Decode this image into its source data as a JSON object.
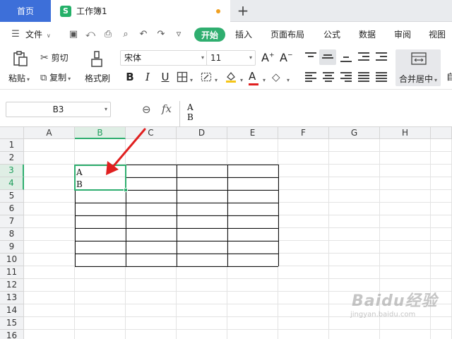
{
  "tabs": {
    "home": "首页",
    "document": "工作簿1",
    "new_tab": "+"
  },
  "menu": {
    "file": "文件",
    "items": [
      "开始",
      "插入",
      "页面布局",
      "公式",
      "数据",
      "审阅",
      "视图"
    ]
  },
  "ribbon": {
    "paste": "粘贴",
    "cut": "剪切",
    "copy": "复制",
    "format_painter": "格式刷",
    "font_name": "宋体",
    "font_size": "11",
    "merge_center": "合并居中",
    "partial_label": "自"
  },
  "formula_bar": {
    "name_box": "B3",
    "fx": "fx",
    "content": "A\nB"
  },
  "sheet": {
    "columns": [
      "A",
      "B",
      "C",
      "D",
      "E",
      "F",
      "G",
      "H"
    ],
    "selected_column": "B",
    "rows": [
      "1",
      "2",
      "3",
      "4",
      "5",
      "6",
      "7",
      "8",
      "9",
      "10",
      "11",
      "12",
      "13",
      "14",
      "15",
      "16"
    ],
    "selected_rows": [
      "3",
      "4"
    ],
    "active_cell_text": "A\nB"
  },
  "watermark": {
    "brand": "Baidu经验",
    "url": "jingyan.baidu.com"
  },
  "colors": {
    "accent_green": "#2fae6f",
    "home_tab_blue": "#3d6fd9",
    "arrow_red": "#e02020"
  }
}
